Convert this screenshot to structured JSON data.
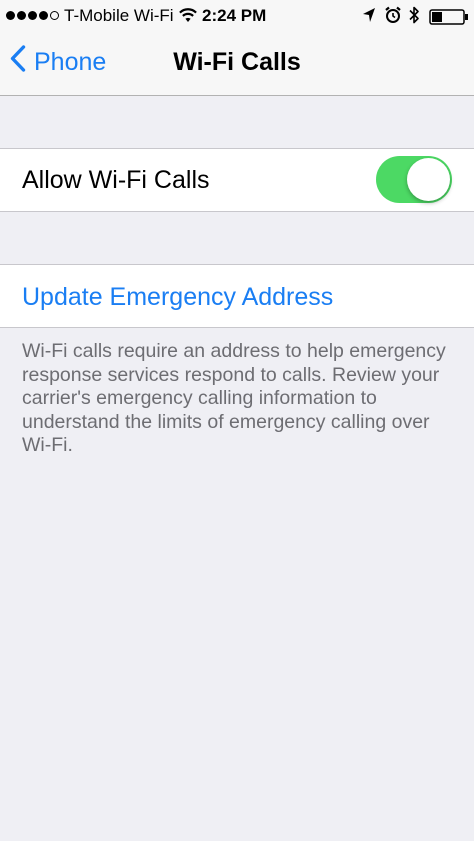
{
  "status_bar": {
    "signal_filled": 4,
    "signal_total": 5,
    "carrier": "T-Mobile Wi-Fi",
    "time": "2:24 PM",
    "icons": [
      "wifi-icon",
      "location-icon",
      "alarm-icon",
      "bluetooth-icon",
      "battery-icon"
    ],
    "battery_level": 0.3
  },
  "nav": {
    "back_label": "Phone",
    "title": "Wi-Fi Calls"
  },
  "settings": {
    "allow_wifi_calls_label": "Allow Wi-Fi Calls",
    "allow_wifi_calls_on": true,
    "update_emergency_label": "Update Emergency Address",
    "footer": "Wi-Fi calls require an address to help emergency response services respond to calls. Review your carrier's emergency calling information to understand the limits of emergency calling over Wi-Fi."
  },
  "colors": {
    "accent": "#1a7ef3",
    "toggle_on": "#4cd964",
    "background": "#efeff4",
    "footer_text": "#6d6d72"
  }
}
